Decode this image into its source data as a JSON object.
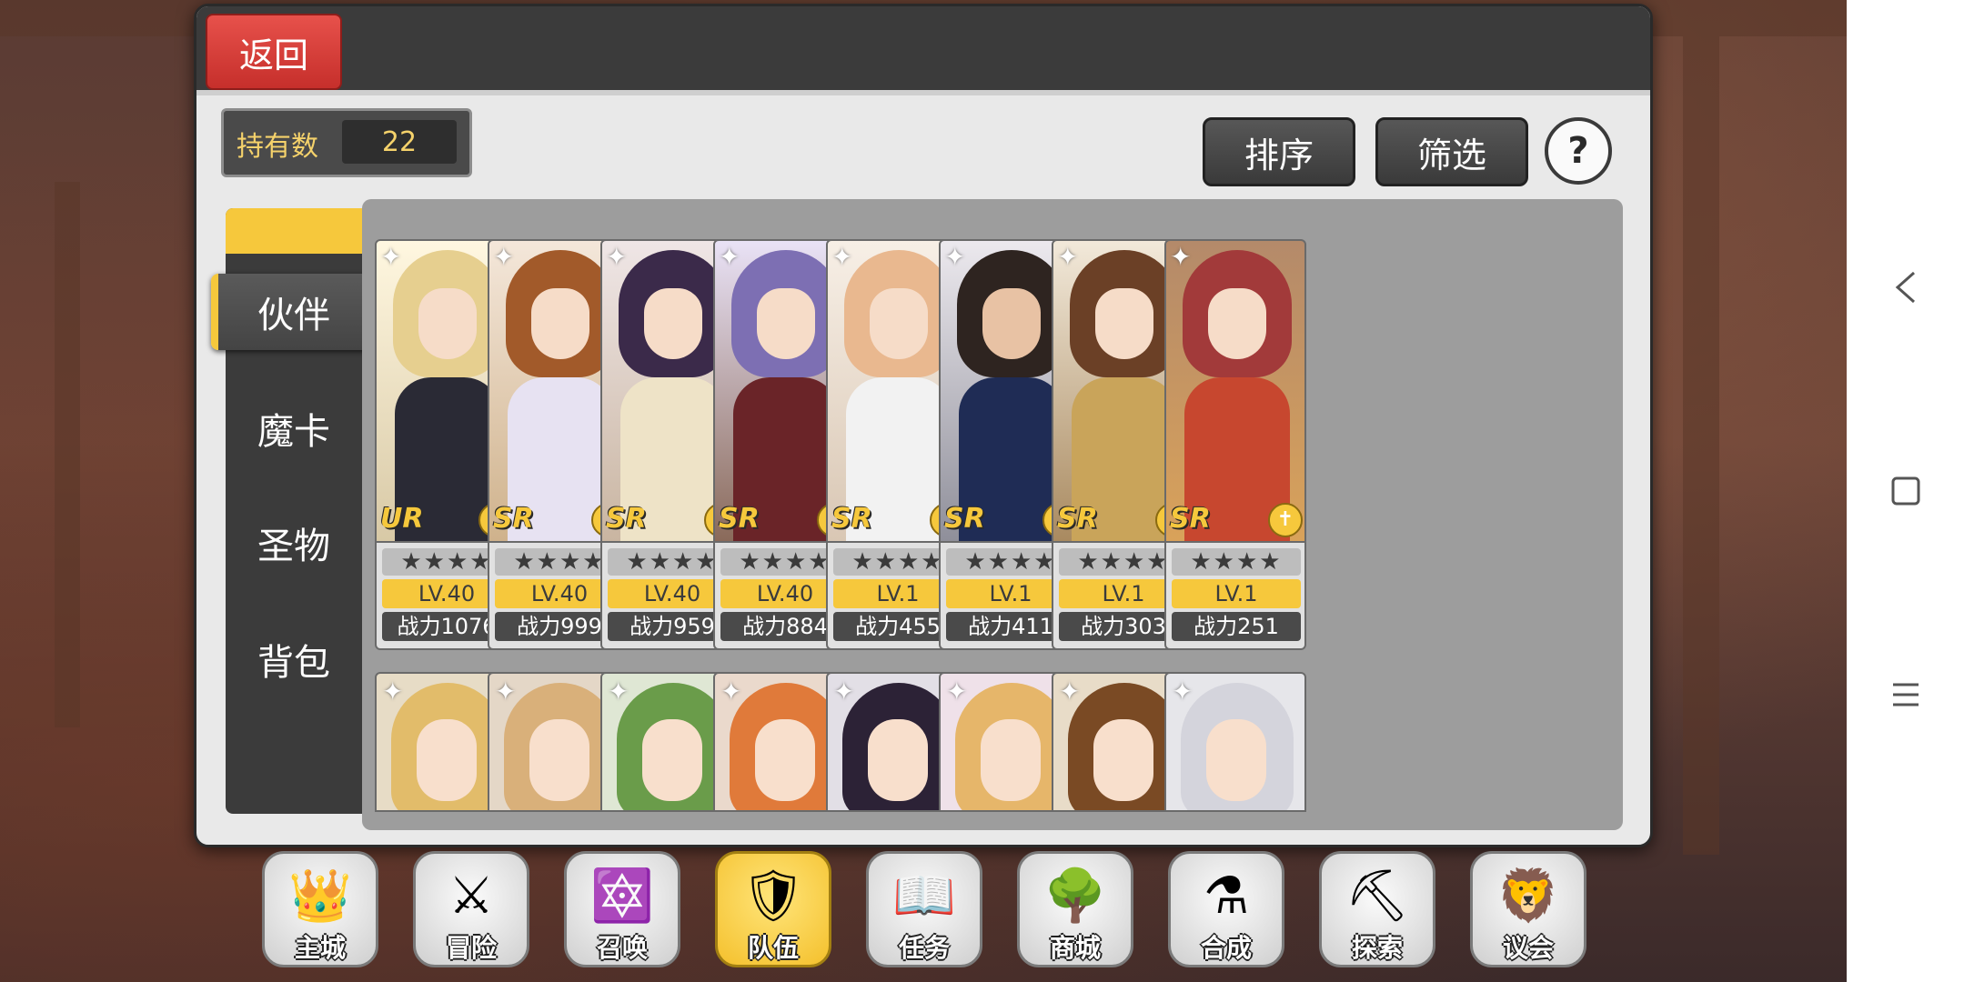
{
  "header": {
    "back_label": "返回"
  },
  "owned": {
    "label": "持有数",
    "value": "22"
  },
  "toolbar": {
    "sort_label": "排序",
    "filter_label": "筛选",
    "help_label": "?"
  },
  "side_tabs": [
    {
      "label": "伙伴",
      "active": true
    },
    {
      "label": "魔卡",
      "active": false
    },
    {
      "label": "圣物",
      "active": false
    },
    {
      "label": "背包",
      "active": false
    }
  ],
  "cards_row1": [
    {
      "rarity": "UR",
      "stars": "★★★★",
      "level": "LV.40",
      "power": "战力1076",
      "class_icon": "bow-icon"
    },
    {
      "rarity": "SR",
      "stars": "★★★★",
      "level": "LV.40",
      "power": "战力999",
      "class_icon": "bow-icon"
    },
    {
      "rarity": "SR",
      "stars": "★★★★",
      "level": "LV.40",
      "power": "战力959",
      "class_icon": "bow-icon"
    },
    {
      "rarity": "SR",
      "stars": "★★★★",
      "level": "LV.40",
      "power": "战力884",
      "class_icon": "cross-icon"
    },
    {
      "rarity": "SR",
      "stars": "★★★★",
      "level": "LV.1",
      "power": "战力455",
      "class_icon": "bow-icon"
    },
    {
      "rarity": "SR",
      "stars": "★★★★",
      "level": "LV.1",
      "power": "战力411",
      "class_icon": "bow-icon"
    },
    {
      "rarity": "SR",
      "stars": "★★★★",
      "level": "LV.1",
      "power": "战力303",
      "class_icon": "shield-icon"
    },
    {
      "rarity": "SR",
      "stars": "★★★★",
      "level": "LV.1",
      "power": "战力251",
      "class_icon": "cross-icon"
    }
  ],
  "bottom_nav": [
    {
      "label": "主城",
      "icon": "crown-icon",
      "active": false
    },
    {
      "label": "冒险",
      "icon": "axes-icon",
      "active": false
    },
    {
      "label": "召唤",
      "icon": "card-summon-icon",
      "active": false
    },
    {
      "label": "队伍",
      "icon": "wings-emblem-icon",
      "active": true
    },
    {
      "label": "任务",
      "icon": "book-icon",
      "active": false
    },
    {
      "label": "商城",
      "icon": "shop-tree-icon",
      "active": false
    },
    {
      "label": "合成",
      "icon": "potion-icon",
      "active": false
    },
    {
      "label": "探索",
      "icon": "shovel-icon",
      "active": false
    },
    {
      "label": "议会",
      "icon": "council-emblem-icon",
      "active": false
    }
  ],
  "android_nav": {
    "back_icon": "back-triangle-icon",
    "home_icon": "home-square-icon",
    "menu_icon": "menu-lines-icon"
  },
  "colors": {
    "accent_yellow": "#f6c83c",
    "back_red": "#d7403b",
    "panel_dark": "#3b3b3b"
  }
}
